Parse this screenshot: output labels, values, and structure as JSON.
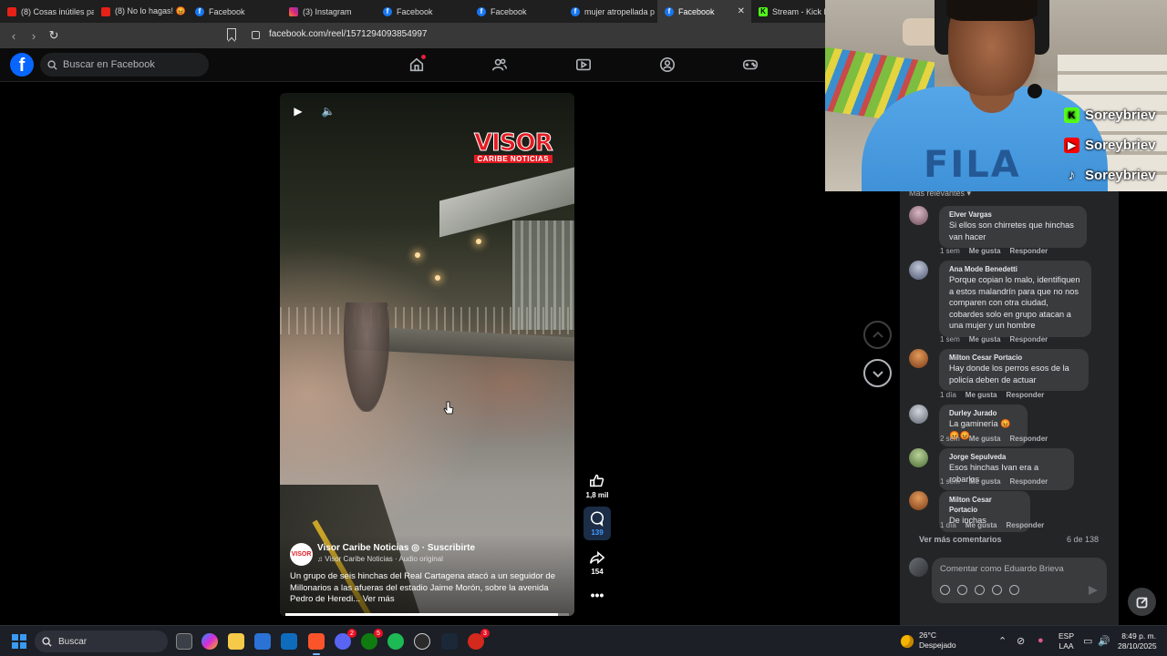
{
  "browser": {
    "tabs": [
      {
        "label": "(8) Cosas inútiles pa",
        "icon": "youtube-icon"
      },
      {
        "label": "(8) No lo hagas! 😡",
        "icon": "youtube-icon"
      },
      {
        "label": "Facebook",
        "icon": "facebook-icon"
      },
      {
        "label": "(3) Instagram",
        "icon": "instagram-icon"
      },
      {
        "label": "Facebook",
        "icon": "facebook-icon"
      },
      {
        "label": "Facebook",
        "icon": "facebook-icon"
      },
      {
        "label": "mujer atropellada p",
        "icon": "facebook-icon"
      },
      {
        "label": "Facebook",
        "icon": "facebook-icon",
        "active": true
      },
      {
        "label": "Stream - Kick D",
        "icon": "kick-icon"
      }
    ],
    "url": "facebook.com/reel/1571294093854997"
  },
  "fb_header": {
    "search_placeholder": "Buscar en Facebook",
    "nav_icons": [
      "home-icon",
      "friends-icon",
      "video-icon",
      "groups-icon",
      "gaming-icon"
    ]
  },
  "reel": {
    "overlay_logo": {
      "top": "VISOR",
      "bottom": "CARIBE NOTICIAS"
    },
    "page_avatar": "VISOR",
    "page_name": "Visor Caribe Noticias",
    "subscribe": "· Suscribirte",
    "audio": "Visor Caribe Noticias · Audio original",
    "caption": "Un grupo de seis hinchas del Real Cartagena atacó a un seguidor de Millonarios a las afueras del estadio Jaime Morón, sobre la avenida Pedro de Heredi...",
    "see_more": "Ver más",
    "progress_fraction": 0.96
  },
  "actions": {
    "likes": "1,8 mil",
    "comments": "139",
    "shares": "154"
  },
  "webcam": {
    "shirt_text": "FILA",
    "socials": [
      {
        "platform": "kick-icon",
        "handle": "Soreybriev"
      },
      {
        "platform": "youtube-icon",
        "handle": "Soreybriev"
      },
      {
        "platform": "tiktok-icon",
        "handle": "Soreybriev"
      }
    ]
  },
  "comments": {
    "sort_label": "Más relevantes ▾",
    "items": [
      {
        "author": "Elver Vargas",
        "text": "Si ellos son chirretes que hinchas van hacer",
        "time": "1 sem",
        "like": "Me gusta",
        "reply": "Responder"
      },
      {
        "author": "Ana Mode Benedetti",
        "text": "Porque copian lo malo, identifiquen a estos malandrín para que no nos comparen con otra ciudad, cobardes solo en grupo atacan a una mujer y un hombre",
        "time": "1 sem",
        "like": "Me gusta",
        "reply": "Responder"
      },
      {
        "author": "Milton Cesar Portacio",
        "text": "Hay donde los perros esos de la policía deben de actuar",
        "time": "1 día",
        "like": "Me gusta",
        "reply": "Responder"
      },
      {
        "author": "Durley Jurado",
        "text": "La gaminería 😡😡😡",
        "time": "2 sem",
        "like": "Me gusta",
        "reply": "Responder"
      },
      {
        "author": "Jorge Sepulveda",
        "text": "Esos hinchas Ivan era a robarlos",
        "time": "1 sem",
        "like": "Me gusta",
        "reply": "Responder"
      },
      {
        "author": "Milton Cesar Portacio",
        "text": "De inchas",
        "time": "1 día",
        "like": "Me gusta",
        "reply": "Responder"
      }
    ],
    "view_more": "Ver más comentarios",
    "count": "6 de 138",
    "compose_placeholder": "Comentar como Eduardo Brieva"
  },
  "taskbar": {
    "search_placeholder": "Buscar",
    "weather_temp": "26°C",
    "weather_desc": "Despejado",
    "lang_top": "ESP",
    "lang_bottom": "LAA",
    "time": "8:49 p. m.",
    "date": "28/10/2025",
    "badges": {
      "discord": "2",
      "xbox": "5",
      "opera": "3"
    }
  }
}
